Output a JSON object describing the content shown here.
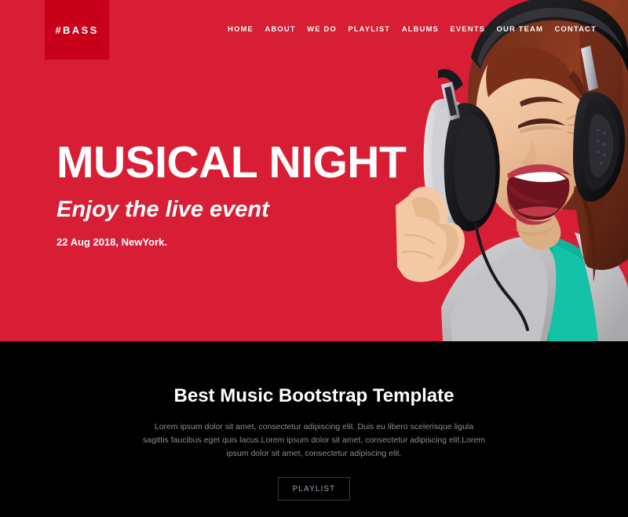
{
  "theme": {
    "hero_red": "#d81e34",
    "logo_red": "#c8001a",
    "dark": "#000000",
    "text_white": "#ffffff",
    "muted_text": "#8d8d93",
    "button_border": "#3a3a3a"
  },
  "header": {
    "logo": "#BASS",
    "nav": [
      {
        "label": "HOME"
      },
      {
        "label": "ABOUT"
      },
      {
        "label": "WE DO"
      },
      {
        "label": "PLAYLIST"
      },
      {
        "label": "ALBUMS"
      },
      {
        "label": "EVENTS"
      },
      {
        "label": "OUR TEAM"
      },
      {
        "label": "CONTACT"
      }
    ]
  },
  "hero": {
    "title": "MUSICAL NIGHT",
    "subtitle": "Enjoy the live event",
    "meta": "22 Aug 2018, NewYork.",
    "photo_alt": "woman-with-headphones-photo"
  },
  "feature": {
    "title": "Best Music Bootstrap Template",
    "description": "Lorem ipsum dolor sit amet, consectetur adipiscing elit. Duis eu libero scelerisque ligula sagittis faucibus eget quis lacus.Lorem ipsum dolor sit amet, consectetur adipiscing elit.Lorem ipsum dolor sit amet, consectetur adipiscing elit.",
    "button_label": "PLAYLIST"
  }
}
